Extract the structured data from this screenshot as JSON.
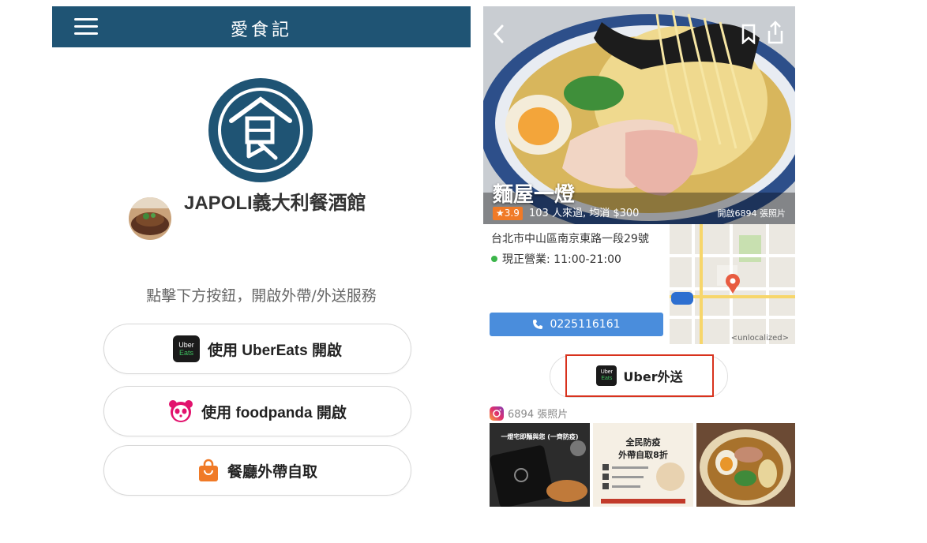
{
  "left_app": {
    "title": "愛食記",
    "restaurant_name": "JAPOLI義大利餐酒館",
    "instruction": "點擊下方按鈕，開啟外帶/外送服務",
    "ubereats_icon": {
      "line1": "Uber",
      "line2": "Eats"
    },
    "buttons": [
      {
        "label": "使用 UberEats 開啟",
        "icon": "ubereats-icon"
      },
      {
        "label": "使用 foodpanda 開啟",
        "icon": "foodpanda-icon"
      },
      {
        "label": "餐廳外帶自取",
        "icon": "shopping-bag-icon"
      }
    ],
    "colors": {
      "header": "#1f5474",
      "accent_orange": "#f07a27",
      "panda_pink": "#e2126d"
    }
  },
  "right_app": {
    "shop_name": "麵屋一燈",
    "rating": "★3.9",
    "stats": "103 人來過, 均消 $300",
    "photo_count_label": "開啟6894 張照片",
    "address": "台北市中山區南京東路一段29號",
    "hours": "現正營業: 11:00-21:00",
    "phone": "0225116161",
    "map_credit": "<unlocalized>",
    "uber_button_label": "Uber外送",
    "uber_icon": {
      "line1": "Uber",
      "line2": "Eats"
    },
    "ig_label": "6894 張照片",
    "thumbs": [
      {
        "heading": "一燈宅即麵與您 (一齊防疫)"
      },
      {
        "heading": "全民防疫",
        "sub": "外帶自取8折"
      }
    ],
    "colors": {
      "call_button": "#4a8ddc",
      "highlight_border": "#d8321d",
      "open_dot": "#3bb54a"
    }
  }
}
